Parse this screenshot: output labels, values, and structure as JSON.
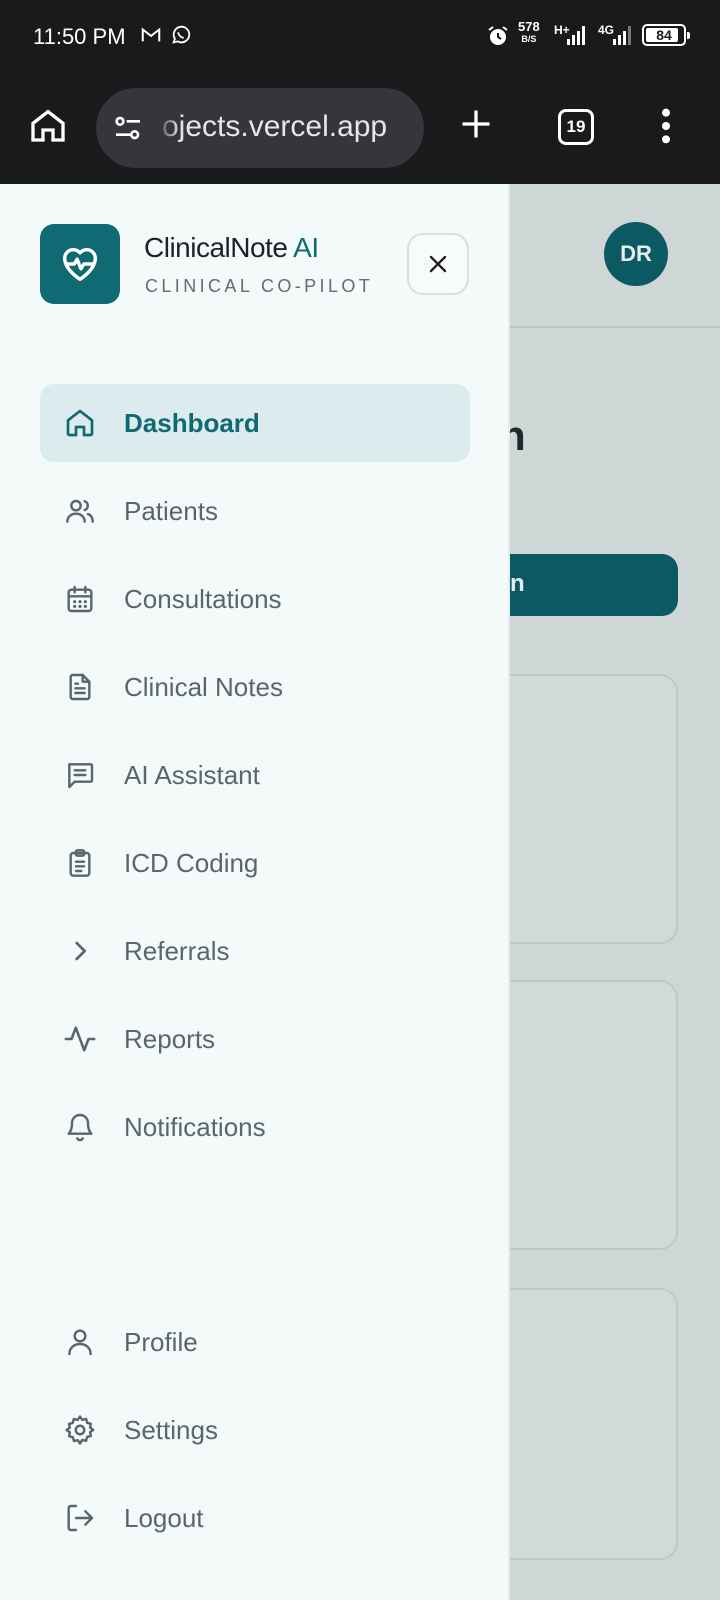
{
  "status_bar": {
    "time": "11:50 PM",
    "net_speed_value": "578",
    "net_speed_unit": "B/S",
    "network_type": "H+",
    "network_type_2": "4G",
    "battery": "84",
    "icons": [
      "gmail-icon",
      "whatsapp-icon",
      "alarm-icon",
      "signal-icon",
      "battery-icon"
    ]
  },
  "browser": {
    "url": "ojects.vercel.app",
    "tab_count": "19"
  },
  "app": {
    "brand_name": "ClinicalNote",
    "brand_accent": "AI",
    "tagline": "CLINICAL CO-PILOT",
    "brand_color": "#0f6a73"
  },
  "background": {
    "avatar_initials": "DR",
    "heading_fragment": "n",
    "button_fragment": "n"
  },
  "nav": {
    "items": [
      {
        "label": "Dashboard",
        "icon": "home-icon",
        "active": true
      },
      {
        "label": "Patients",
        "icon": "users-icon"
      },
      {
        "label": "Consultations",
        "icon": "calendar-icon"
      },
      {
        "label": "Clinical Notes",
        "icon": "file-text-icon"
      },
      {
        "label": "AI Assistant",
        "icon": "message-square-icon"
      },
      {
        "label": "ICD Coding",
        "icon": "clipboard-icon"
      },
      {
        "label": "Referrals",
        "icon": "chevron-right-icon"
      },
      {
        "label": "Reports",
        "icon": "activity-icon"
      },
      {
        "label": "Notifications",
        "icon": "bell-icon"
      }
    ],
    "bottom_items": [
      {
        "label": "Profile",
        "icon": "user-icon"
      },
      {
        "label": "Settings",
        "icon": "gear-icon"
      },
      {
        "label": "Logout",
        "icon": "logout-icon"
      }
    ]
  }
}
